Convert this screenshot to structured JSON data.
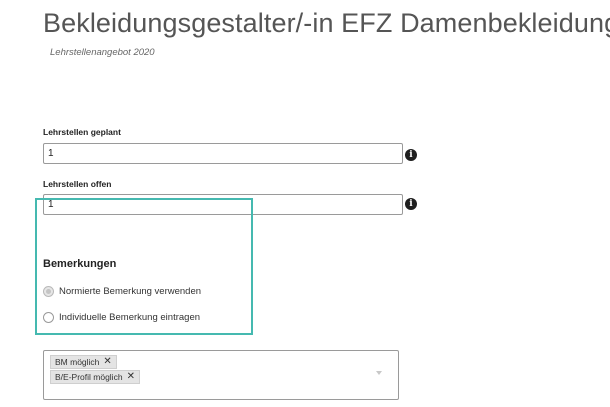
{
  "header": {
    "title": "Bekleidungsgestalter/-in EFZ Damenbekleidung",
    "subtitle": "Lehrstellenangebot 2020"
  },
  "fields": {
    "planned": {
      "label": "Lehrstellen geplant",
      "value": "1",
      "info_icon": "info-icon"
    },
    "open": {
      "label": "Lehrstellen offen",
      "value": "1",
      "info_icon": "info-icon"
    }
  },
  "remarks": {
    "title": "Bemerkungen",
    "options": [
      {
        "label": "Normierte Bemerkung verwenden",
        "selected": true
      },
      {
        "label": "Individuelle Bemerkung eintragen",
        "selected": false
      }
    ],
    "highlight_color": "#45b9b0"
  },
  "tags": {
    "items": [
      {
        "label": "BM möglich",
        "remove": "✕"
      },
      {
        "label": "B/E-Profil möglich",
        "remove": "✕"
      }
    ]
  }
}
